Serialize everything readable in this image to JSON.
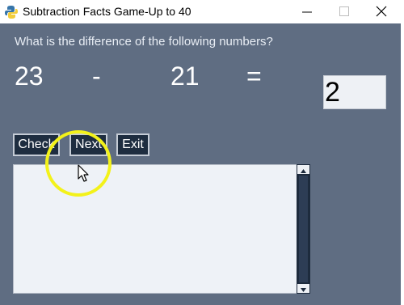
{
  "window": {
    "title": "Subtraction Facts Game-Up to 40",
    "icons": [
      "python-icon",
      "minimize-icon",
      "maximize-icon",
      "close-icon"
    ]
  },
  "question": "What is the difference of the following numbers?",
  "equation": {
    "first_number": "23",
    "operator": "-",
    "second_number": "21",
    "equals": "="
  },
  "answer": {
    "value": "2"
  },
  "buttons": {
    "check": "Check",
    "next": "Next",
    "exit": "Exit"
  },
  "output_text": "",
  "colors": {
    "background": "#5f6d82",
    "button": "#1e2d40",
    "highlight": "#f3f21a"
  }
}
